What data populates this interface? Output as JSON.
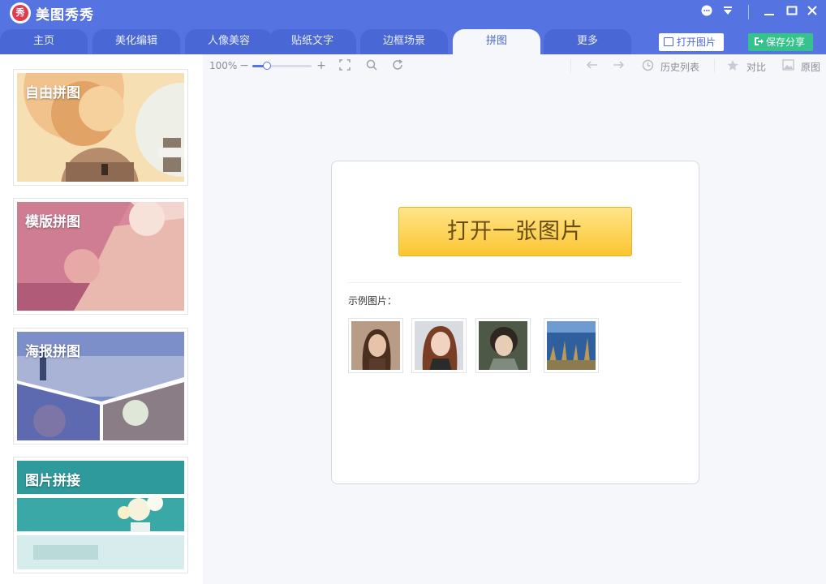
{
  "app": {
    "title": "美图秀秀",
    "logo_text": "秀"
  },
  "tabs": [
    {
      "label": "主页",
      "active": false
    },
    {
      "label": "美化编辑",
      "active": false
    },
    {
      "label": "人像美容",
      "active": false
    },
    {
      "label": "贴纸文字",
      "active": false
    },
    {
      "label": "边框场景",
      "active": false
    },
    {
      "label": "拼图",
      "active": true
    },
    {
      "label": "更多",
      "active": false
    }
  ],
  "actions": {
    "open_image": "打开图片",
    "save_share": "保存分享"
  },
  "sidebar": {
    "items": [
      {
        "label": "自由拼图"
      },
      {
        "label": "模版拼图"
      },
      {
        "label": "海报拼图"
      },
      {
        "label": "图片拼接"
      }
    ]
  },
  "toolbar": {
    "zoom": "100%",
    "zoom_level": 0.25,
    "history": "历史列表",
    "compare": "对比",
    "original": "原图"
  },
  "main": {
    "open_one_image": "打开一张图片",
    "sample_label": "示例图片："
  },
  "colors": {
    "brand": "#5573e1",
    "tab_inactive": "#4968d6",
    "save_green": "#36c38b",
    "open_button_yellow": "#fbc530"
  }
}
